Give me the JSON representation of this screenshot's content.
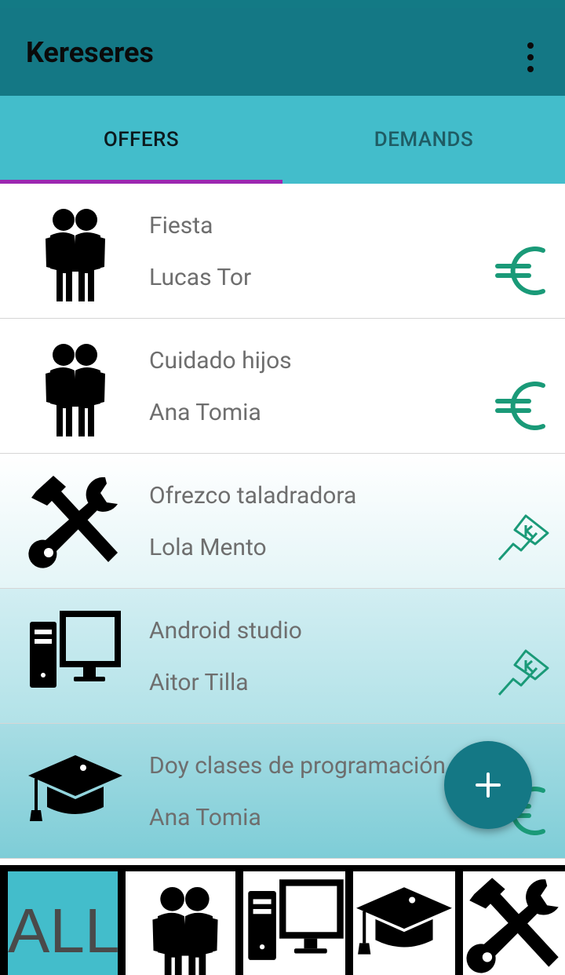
{
  "app": {
    "title": "Kereseres"
  },
  "tabs": [
    {
      "label": "OFFERS",
      "selected": true
    },
    {
      "label": "DEMANDS",
      "selected": false
    }
  ],
  "items": [
    {
      "title": "Fiesta",
      "user": "Lucas Tor",
      "category_icon": "people-icon",
      "type_icon": "euro-icon"
    },
    {
      "title": "Cuidado hijos",
      "user": "Ana Tomia",
      "category_icon": "people-icon",
      "type_icon": "euro-icon"
    },
    {
      "title": "Ofrezco taladradora",
      "user": "Lola Mento",
      "category_icon": "tools-icon",
      "type_icon": "barter-icon"
    },
    {
      "title": "Android studio",
      "user": "Aitor Tilla",
      "category_icon": "computer-icon",
      "type_icon": "barter-icon"
    },
    {
      "title": "Doy clases de programación",
      "user": "Ana Tomia",
      "category_icon": "graduation-cap-icon",
      "type_icon": "euro-icon"
    }
  ],
  "fab": {
    "icon": "plus-icon"
  },
  "categories": [
    {
      "label": "ALL",
      "selected": true
    },
    {
      "icon": "people-icon"
    },
    {
      "icon": "computer-icon"
    },
    {
      "icon": "graduation-cap-icon"
    },
    {
      "icon": "tools-icon"
    }
  ],
  "colors": {
    "appbar": "#147885",
    "tabs": "#43bdcb",
    "indicator": "#9c27b0",
    "accent_green": "#1a9a78"
  }
}
